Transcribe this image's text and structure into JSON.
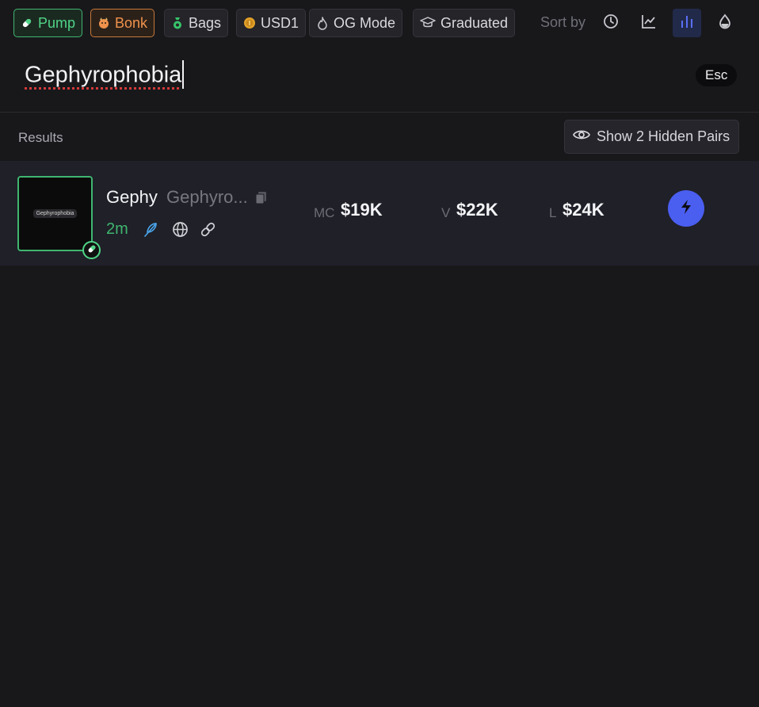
{
  "filters": [
    {
      "id": "pump",
      "label": "Pump",
      "icon": "pill-icon"
    },
    {
      "id": "bonk",
      "label": "Bonk",
      "icon": "bonk-dog-icon"
    },
    {
      "id": "bags",
      "label": "Bags",
      "icon": "money-bag-icon"
    },
    {
      "id": "usd1",
      "label": "USD1",
      "icon": "coin-icon"
    },
    {
      "id": "ogmode",
      "label": "OG Mode",
      "icon": "flame-icon"
    },
    {
      "id": "graduated",
      "label": "Graduated",
      "icon": "graduation-cap-icon"
    }
  ],
  "sort": {
    "label": "Sort by",
    "options": [
      "clock-icon",
      "line-chart-icon",
      "bar-chart-icon",
      "droplet-icon"
    ],
    "active": "bar-chart-icon"
  },
  "search": {
    "query": "Gephyrophobia",
    "esc_label": "Esc"
  },
  "results": {
    "label": "Results",
    "hidden_pairs_label": "Show 2 Hidden Pairs"
  },
  "token": {
    "image_text": "Gephyrophobia",
    "symbol": "Gephy",
    "name": "Gephyro...",
    "age": "2m",
    "mc_label": "MC",
    "mc_value": "$19K",
    "v_label": "V",
    "v_value": "$22K",
    "l_label": "L",
    "l_value": "$24K"
  },
  "colors": {
    "pump": "#4fd487",
    "bonk": "#f0924c",
    "accent": "#4a5ef0",
    "background": "#18181b"
  }
}
